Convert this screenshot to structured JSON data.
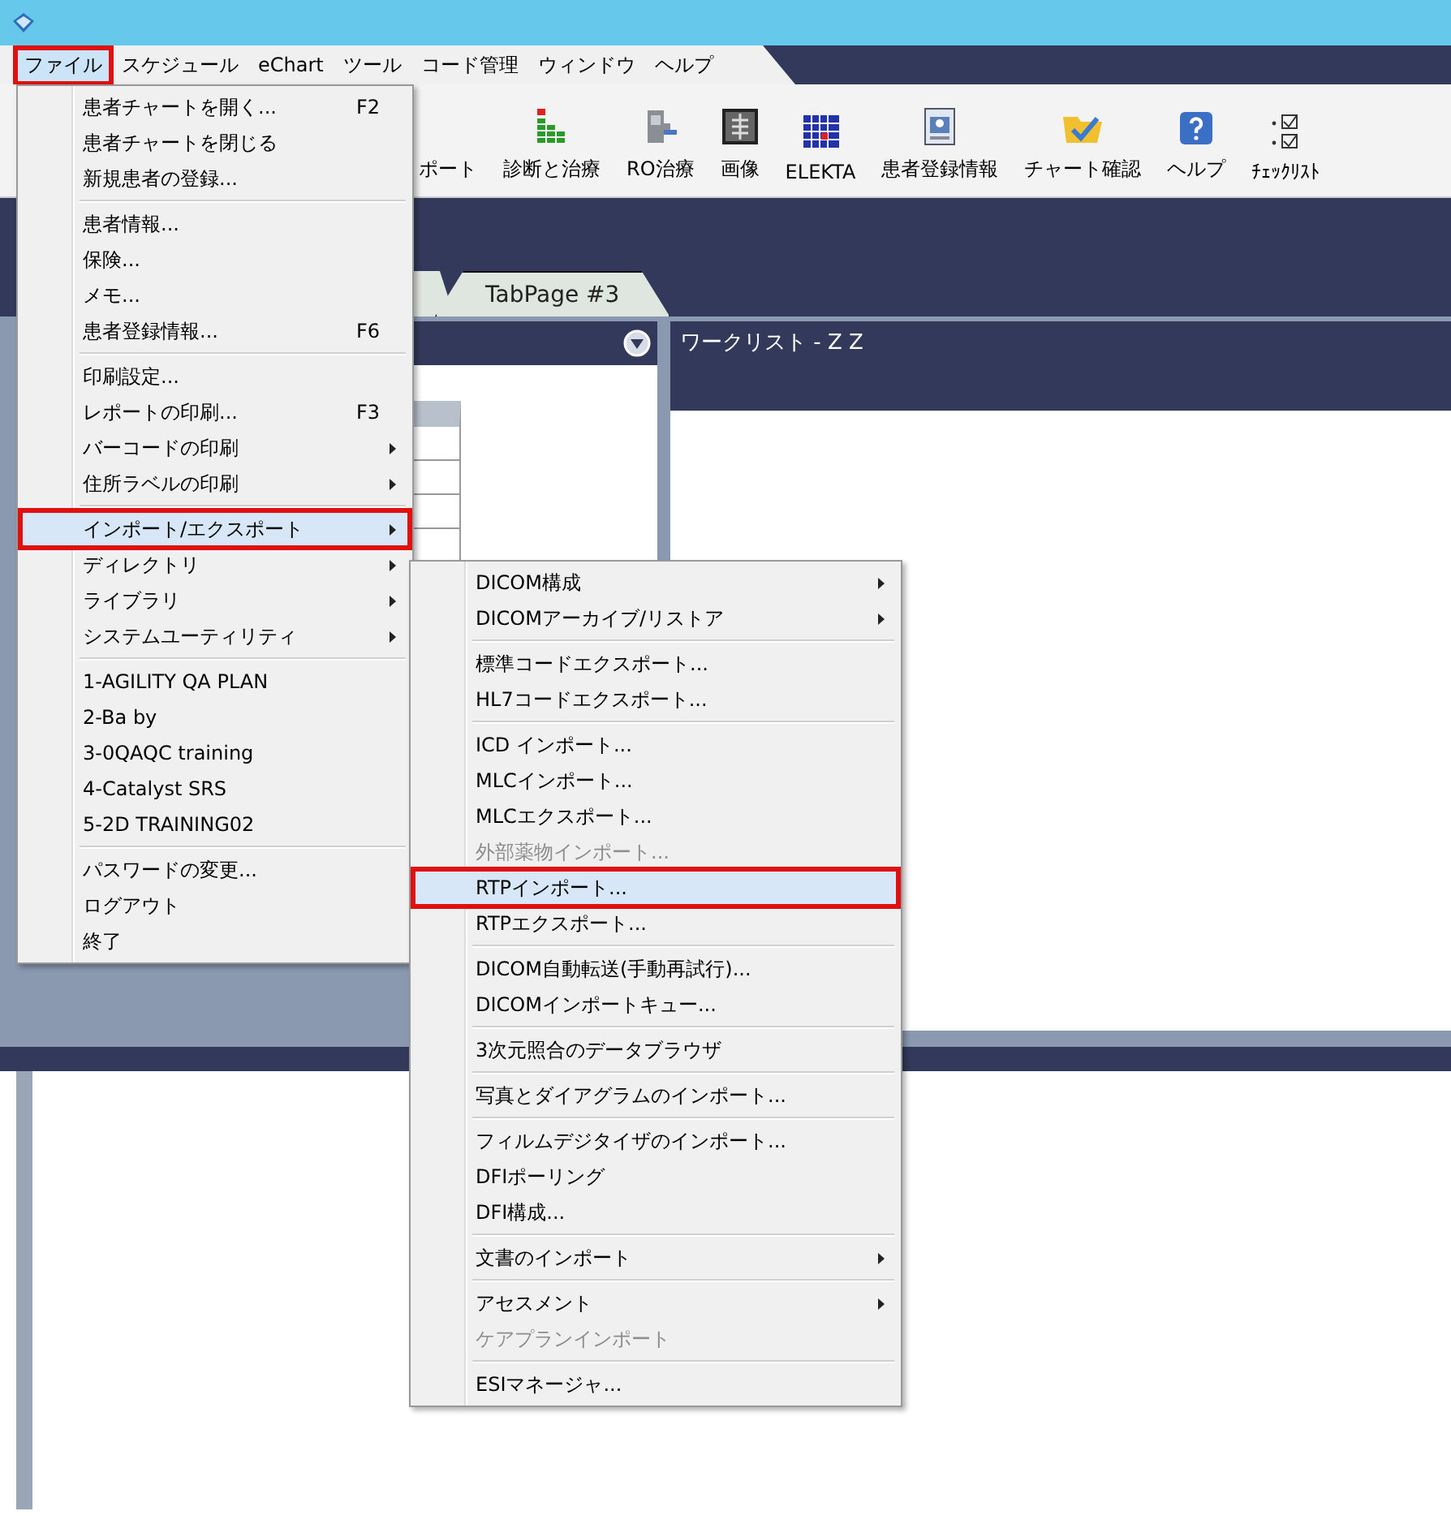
{
  "menu_bar": [
    {
      "label": "ファイル",
      "selected": true,
      "marked": true
    },
    {
      "label": "スケジュール",
      "selected": false,
      "marked": false
    },
    {
      "label": "eChart",
      "selected": false,
      "marked": false
    },
    {
      "label": "ツール",
      "selected": false,
      "marked": false
    },
    {
      "label": "コード管理",
      "selected": false,
      "marked": false
    },
    {
      "label": "ウィンドウ",
      "selected": false,
      "marked": false
    },
    {
      "label": "ヘルプ",
      "selected": false,
      "marked": false
    }
  ],
  "toolbar": [
    {
      "label": "ポート"
    },
    {
      "label": "診断と治療"
    },
    {
      "label": "RO治療"
    },
    {
      "label": "画像"
    },
    {
      "label": "ELEKTA"
    },
    {
      "label": "患者登録情報"
    },
    {
      "label": "チャート確認"
    },
    {
      "label": "ヘルプ"
    },
    {
      "label": "ﾁｪｯｸﾘｽﾄ"
    }
  ],
  "tabs": [
    {
      "label": "TabPage #3",
      "selected": false
    }
  ],
  "worklist": {
    "title": "ワークリスト - Z Z"
  },
  "file_menu": [
    {
      "kind": "item",
      "label": "患者チャートを開く...",
      "shortcut": "F2",
      "has_submenu": false,
      "selected": false,
      "disabled": false,
      "marked": false
    },
    {
      "kind": "item",
      "label": "患者チャートを閉じる",
      "has_submenu": false,
      "selected": false,
      "disabled": false,
      "marked": false
    },
    {
      "kind": "item",
      "label": "新規患者の登録...",
      "has_submenu": false,
      "selected": false,
      "disabled": false,
      "marked": false
    },
    {
      "kind": "separator"
    },
    {
      "kind": "item",
      "label": "患者情報...",
      "has_submenu": false,
      "selected": false,
      "disabled": false,
      "marked": false
    },
    {
      "kind": "item",
      "label": "保険...",
      "has_submenu": false,
      "selected": false,
      "disabled": false,
      "marked": false
    },
    {
      "kind": "item",
      "label": "メモ...",
      "has_submenu": false,
      "selected": false,
      "disabled": false,
      "marked": false
    },
    {
      "kind": "item",
      "label": "患者登録情報...",
      "shortcut": "F6",
      "has_submenu": false,
      "selected": false,
      "disabled": false,
      "marked": false
    },
    {
      "kind": "separator"
    },
    {
      "kind": "item",
      "label": "印刷設定...",
      "has_submenu": false,
      "selected": false,
      "disabled": false,
      "marked": false
    },
    {
      "kind": "item",
      "label": "レポートの印刷...",
      "shortcut": "F3",
      "has_submenu": false,
      "selected": false,
      "disabled": false,
      "marked": false
    },
    {
      "kind": "item",
      "label": "バーコードの印刷",
      "has_submenu": true,
      "selected": false,
      "disabled": false,
      "marked": false
    },
    {
      "kind": "item",
      "label": "住所ラベルの印刷",
      "has_submenu": true,
      "selected": false,
      "disabled": false,
      "marked": false
    },
    {
      "kind": "separator"
    },
    {
      "kind": "item",
      "label": "インポート/エクスポート",
      "has_submenu": true,
      "selected": true,
      "disabled": false,
      "marked": true
    },
    {
      "kind": "item",
      "label": "ディレクトリ",
      "has_submenu": true,
      "selected": false,
      "disabled": false,
      "marked": false
    },
    {
      "kind": "item",
      "label": "ライブラリ",
      "has_submenu": true,
      "selected": false,
      "disabled": false,
      "marked": false
    },
    {
      "kind": "item",
      "label": "システムユーティリティ",
      "has_submenu": true,
      "selected": false,
      "disabled": false,
      "marked": false
    },
    {
      "kind": "separator"
    },
    {
      "kind": "item",
      "label": "1-AGILITY QA  PLAN",
      "has_submenu": false,
      "selected": false,
      "disabled": false,
      "marked": false
    },
    {
      "kind": "item",
      "label": "2-Ba by",
      "has_submenu": false,
      "selected": false,
      "disabled": false,
      "marked": false
    },
    {
      "kind": "item",
      "label": "3-0QAQC training",
      "has_submenu": false,
      "selected": false,
      "disabled": false,
      "marked": false
    },
    {
      "kind": "item",
      "label": "4-Catalyst SRS",
      "has_submenu": false,
      "selected": false,
      "disabled": false,
      "marked": false
    },
    {
      "kind": "item",
      "label": "5-2D TRAINING02",
      "has_submenu": false,
      "selected": false,
      "disabled": false,
      "marked": false
    },
    {
      "kind": "separator"
    },
    {
      "kind": "item",
      "label": "パスワードの変更...",
      "has_submenu": false,
      "selected": false,
      "disabled": false,
      "marked": false
    },
    {
      "kind": "item",
      "label": "ログアウト",
      "has_submenu": false,
      "selected": false,
      "disabled": false,
      "marked": false
    },
    {
      "kind": "item",
      "label": "終了",
      "has_submenu": false,
      "selected": false,
      "disabled": false,
      "marked": false
    }
  ],
  "import_export_menu": [
    {
      "kind": "item",
      "label": "DICOM構成",
      "has_submenu": true,
      "selected": false,
      "disabled": false,
      "marked": false
    },
    {
      "kind": "item",
      "label": "DICOMアーカイブ/リストア",
      "has_submenu": true,
      "selected": false,
      "disabled": false,
      "marked": false
    },
    {
      "kind": "separator"
    },
    {
      "kind": "item",
      "label": "標準コードエクスポート...",
      "has_submenu": false,
      "selected": false,
      "disabled": false,
      "marked": false
    },
    {
      "kind": "item",
      "label": "HL7コードエクスポート...",
      "has_submenu": false,
      "selected": false,
      "disabled": false,
      "marked": false
    },
    {
      "kind": "separator"
    },
    {
      "kind": "item",
      "label": "ICD インポート...",
      "has_submenu": false,
      "selected": false,
      "disabled": false,
      "marked": false
    },
    {
      "kind": "item",
      "label": "MLCインポート...",
      "has_submenu": false,
      "selected": false,
      "disabled": false,
      "marked": false
    },
    {
      "kind": "item",
      "label": "MLCエクスポート...",
      "has_submenu": false,
      "selected": false,
      "disabled": false,
      "marked": false
    },
    {
      "kind": "item",
      "label": "外部薬物インポート...",
      "has_submenu": false,
      "selected": false,
      "disabled": true,
      "marked": false
    },
    {
      "kind": "item",
      "label": "RTPインポート...",
      "has_submenu": false,
      "selected": true,
      "disabled": false,
      "marked": true
    },
    {
      "kind": "item",
      "label": "RTPエクスポート...",
      "has_submenu": false,
      "selected": false,
      "disabled": false,
      "marked": false
    },
    {
      "kind": "separator"
    },
    {
      "kind": "item",
      "label": "DICOM自動転送(手動再試行)...",
      "has_submenu": false,
      "selected": false,
      "disabled": false,
      "marked": false
    },
    {
      "kind": "item",
      "label": "DICOMインポートキュー...",
      "has_submenu": false,
      "selected": false,
      "disabled": false,
      "marked": false
    },
    {
      "kind": "separator"
    },
    {
      "kind": "item",
      "label": "3次元照合のデータブラウザ",
      "has_submenu": false,
      "selected": false,
      "disabled": false,
      "marked": false
    },
    {
      "kind": "separator"
    },
    {
      "kind": "item",
      "label": "写真とダイアグラムのインポート...",
      "has_submenu": false,
      "selected": false,
      "disabled": false,
      "marked": false
    },
    {
      "kind": "separator"
    },
    {
      "kind": "item",
      "label": "フィルムデジタイザのインポート...",
      "has_submenu": false,
      "selected": false,
      "disabled": false,
      "marked": false
    },
    {
      "kind": "item",
      "label": "DFIポーリング",
      "has_submenu": false,
      "selected": false,
      "disabled": false,
      "marked": false
    },
    {
      "kind": "item",
      "label": "DFI構成...",
      "has_submenu": false,
      "selected": false,
      "disabled": false,
      "marked": false
    },
    {
      "kind": "separator"
    },
    {
      "kind": "item",
      "label": "文書のインポート",
      "has_submenu": true,
      "selected": false,
      "disabled": false,
      "marked": false
    },
    {
      "kind": "separator"
    },
    {
      "kind": "item",
      "label": "アセスメント",
      "has_submenu": true,
      "selected": false,
      "disabled": false,
      "marked": false
    },
    {
      "kind": "item",
      "label": "ケアプランインポート",
      "has_submenu": false,
      "selected": false,
      "disabled": true,
      "marked": false
    },
    {
      "kind": "separator"
    },
    {
      "kind": "item",
      "label": "ESIマネージャ...",
      "has_submenu": false,
      "selected": false,
      "disabled": false,
      "marked": false
    }
  ]
}
